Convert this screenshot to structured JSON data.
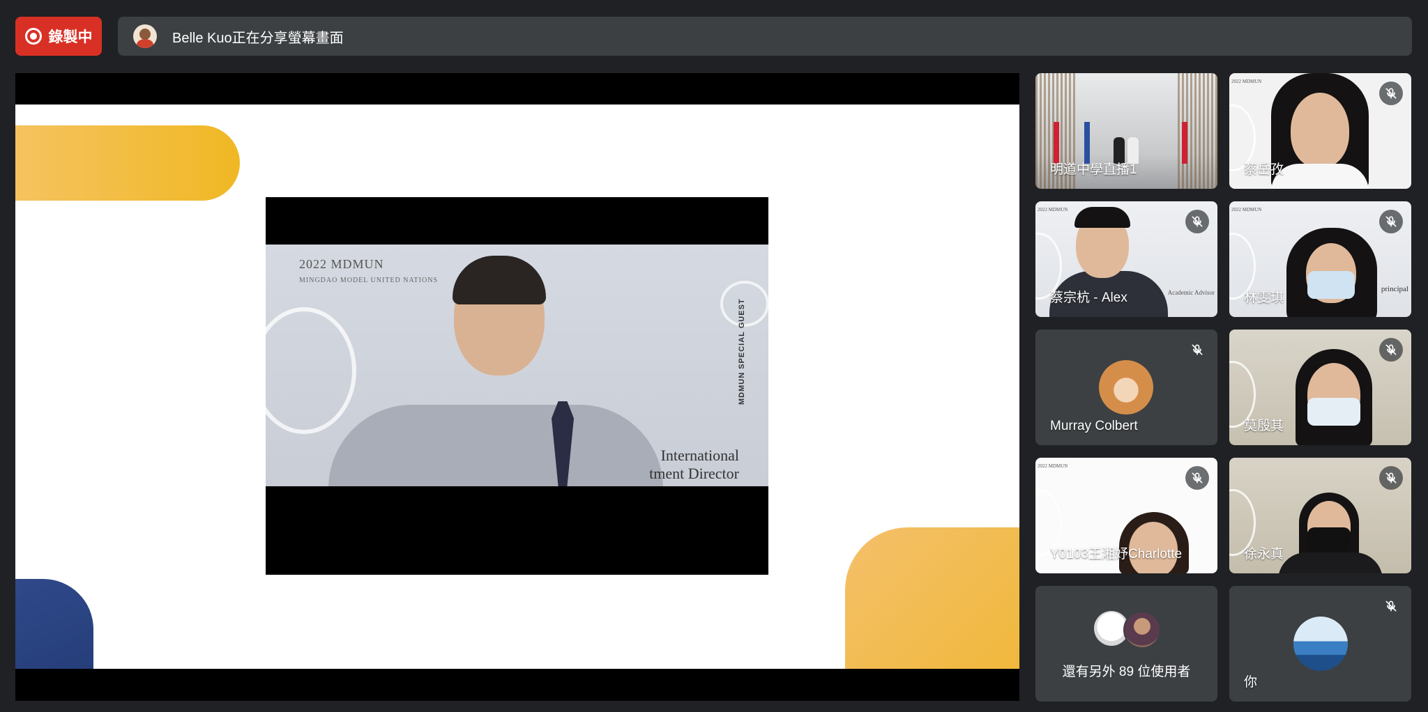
{
  "recording": {
    "label": "錄製中",
    "color": "#d93025"
  },
  "share_bar": {
    "text": "Belle Kuo正在分享螢幕畫面"
  },
  "presentation": {
    "video": {
      "title": "2022 MDMUN",
      "subtitle": "MINGDAO MODEL UNITED NATIONS",
      "vertical_text": "MDMUN SPECIAL GUEST",
      "caption_line1": "International",
      "caption_line2": "tment Director"
    },
    "colors": {
      "accent_yellow": "#f0b824",
      "accent_navy": "#243d78"
    }
  },
  "participants": [
    {
      "name": "明道中學直播1",
      "muted": false
    },
    {
      "name": "蔡岳孜",
      "muted": true
    },
    {
      "name": "蔡宗杭 - Alex",
      "muted": true,
      "bg_caption": "Academic Advisor"
    },
    {
      "name": "林雯琪",
      "muted": true,
      "bg_caption": "principal"
    },
    {
      "name": "Murray Colbert",
      "muted": true
    },
    {
      "name": "莫殷其",
      "muted": true
    },
    {
      "name": "Y0103王湘妤Charlotte",
      "muted": true
    },
    {
      "name": "徐永真",
      "muted": true
    },
    {
      "name": "還有另外 89 位使用者",
      "muted": false
    },
    {
      "name": "你",
      "muted": true
    }
  ],
  "tile_bg_label": "2022 MDMUN",
  "icons": {
    "mic_off": "mic-off-icon",
    "record": "record-icon"
  }
}
